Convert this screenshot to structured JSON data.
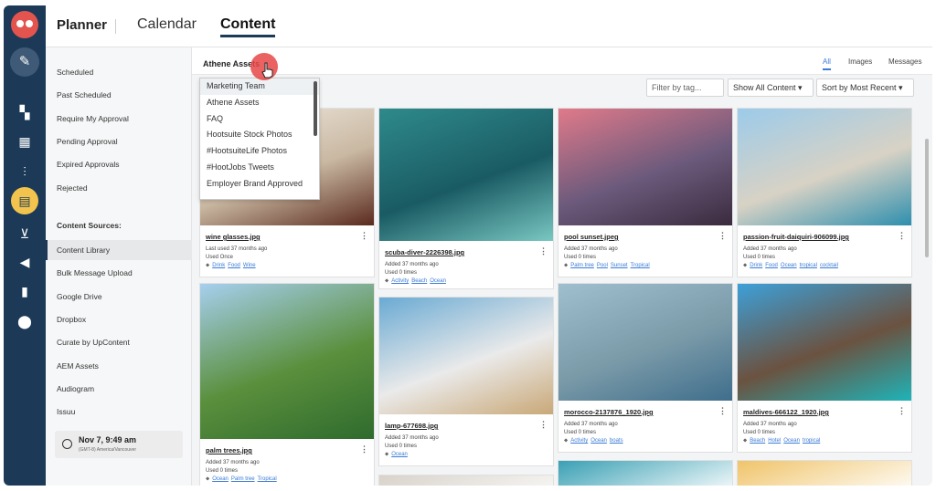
{
  "header": {
    "app_title": "Planner",
    "tabs": [
      {
        "label": "Calendar"
      },
      {
        "label": "Content"
      }
    ]
  },
  "rail": {
    "icons": [
      "owl-logo-icon",
      "compose-icon",
      "boards-icon",
      "dashboard-icon",
      "streams-icon",
      "planner-icon",
      "inbox-icon",
      "megaphone-icon",
      "analytics-icon",
      "location-icon"
    ]
  },
  "sidebar": {
    "items": [
      "Scheduled",
      "Past Scheduled",
      "Require My Approval",
      "Pending Approval",
      "Expired Approvals",
      "Rejected"
    ],
    "section_title": "Content Sources:",
    "sources": [
      "Content Library",
      "Bulk Message Upload",
      "Google Drive",
      "Dropbox",
      "Curate by UpContent",
      "AEM Assets",
      "Audiogram",
      "Issuu"
    ],
    "clock": {
      "time": "Nov 7, 9:49 am",
      "timezone": "(GMT-8) America/Vancouver"
    }
  },
  "main": {
    "breadcrumb": "Athene Assets",
    "view_tabs": [
      "All",
      "Images",
      "Messages"
    ],
    "filter_placeholder": "Filter by tag...",
    "show_select": "Show All Content ▾",
    "sort_select": "Sort by Most Recent ▾"
  },
  "dropdown": {
    "options": [
      "Marketing Team",
      "Athene Assets",
      "FAQ",
      "Hootsuite Stock Photos",
      "#HootsuiteLife Photos",
      "#HootJobs Tweets",
      "Employer Brand Approved"
    ]
  },
  "cards": [
    {
      "name": "wine glasses.jpg",
      "meta1": "Last used 37 months ago",
      "meta2": "Used Once",
      "tags": [
        "Drink",
        "Food",
        "Wine"
      ],
      "colors": [
        "#f4eee6",
        "#5a2a1e",
        "#c9b8a2"
      ]
    },
    {
      "name": "scuba-diver-2226398.jpg",
      "meta1": "Added 37 months ago",
      "meta2": "Used 0 times",
      "tags": [
        "Activity",
        "Beach",
        "Ocean"
      ],
      "colors": [
        "#2e8a8c",
        "#79c7c2",
        "#1a5b63"
      ]
    },
    {
      "name": "pool sunset.jpeg",
      "meta1": "Added 37 months ago",
      "meta2": "Used 0 times",
      "tags": [
        "Palm tree",
        "Pool",
        "Sunset",
        "Tropical"
      ],
      "colors": [
        "#e07a8a",
        "#3a2b3e",
        "#6c5a7c"
      ]
    },
    {
      "name": "passion-fruit-daiquiri-906099.jpg",
      "meta1": "Added 37 months ago",
      "meta2": "Used 0 times",
      "tags": [
        "Drink",
        "Food",
        "Ocean",
        "tropical",
        "cocktail"
      ],
      "colors": [
        "#9ccbea",
        "#2e8fae",
        "#d8d2c5"
      ]
    },
    {
      "name": "palm trees.jpg",
      "meta1": "Added 37 months ago",
      "meta2": "Used 0 times",
      "tags": [
        "Ocean",
        "Palm tree",
        "Tropical"
      ],
      "colors": [
        "#a6cfee",
        "#2f6b2e",
        "#5a8f3c"
      ]
    },
    {
      "name": "lamp-677698.jpg",
      "meta1": "Added 37 months ago",
      "meta2": "Used 0 times",
      "tags": [
        "Ocean"
      ],
      "colors": [
        "#6aaad3",
        "#c9a877",
        "#eaeaea"
      ]
    },
    {
      "name": "morocco-2137876_1920.jpg",
      "meta1": "Added 37 months ago",
      "meta2": "Used 0 times",
      "tags": [
        "Activity",
        "Ocean",
        "boats"
      ],
      "colors": [
        "#9fbfcf",
        "#3f6e8c",
        "#7a9aa8"
      ]
    },
    {
      "name": "maldives-666122_1920.jpg",
      "meta1": "Added 37 months ago",
      "meta2": "Used 0 times",
      "tags": [
        "Beach",
        "Hotel",
        "Ocean",
        "tropical"
      ],
      "colors": [
        "#3da0d8",
        "#1fb3b8",
        "#6b5240"
      ]
    }
  ]
}
